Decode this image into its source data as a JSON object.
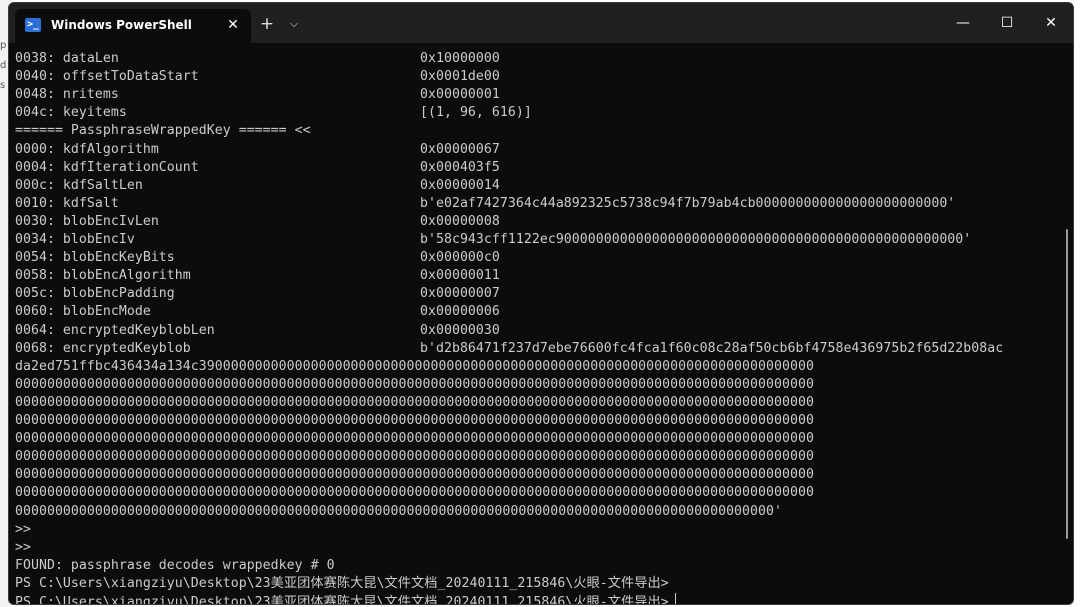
{
  "window": {
    "tab_title": "Windows PowerShell",
    "tab_icon": "powershell-icon",
    "close_tab_icon": "close-icon",
    "new_tab_icon": "plus-icon",
    "dropdown_icon": "chevron-down-icon",
    "minimize_icon": "minimize-icon",
    "maximize_icon": "maximize-icon",
    "close_icon": "close-icon"
  },
  "behind_window": {
    "fragments": [
      "p",
      "d",
      "s"
    ]
  },
  "terminal": {
    "rows": [
      {
        "key": "0038: dataLen",
        "value": "0x10000000"
      },
      {
        "key": "0040: offsetToDataStart",
        "value": "0x0001de00"
      },
      {
        "key": "0048: nritems",
        "value": "0x00000001"
      },
      {
        "key": "004c: keyitems",
        "value": "[(1, 96, 616)]"
      },
      {
        "key": "====== PassphraseWrappedKey ====== <<",
        "value": ""
      },
      {
        "key": "0000: kdfAlgorithm",
        "value": "0x00000067"
      },
      {
        "key": "0004: kdfIterationCount",
        "value": "0x000403f5"
      },
      {
        "key": "000c: kdfSaltLen",
        "value": "0x00000014"
      },
      {
        "key": "0010: kdfSalt",
        "value": "b'e02af7427364c44a892325c5738c94f7b79ab4cb000000000000000000000000'"
      },
      {
        "key": "0030: blobEncIvLen",
        "value": "0x00000008"
      },
      {
        "key": "0034: blobEncIv",
        "value": "b'58c943cff1122ec900000000000000000000000000000000000000000000000000'"
      },
      {
        "key": "0054: blobEncKeyBits",
        "value": "0x000000c0"
      },
      {
        "key": "0058: blobEncAlgorithm",
        "value": "0x00000011"
      },
      {
        "key": "005c: blobEncPadding",
        "value": "0x00000007"
      },
      {
        "key": "0060: blobEncMode",
        "value": "0x00000006"
      },
      {
        "key": "0064: encryptedKeyblobLen",
        "value": "0x00000030"
      },
      {
        "key": "0068: encryptedKeyblob",
        "value": "b'd2b86471f237d7ebe76600fc4fca1f60c08c28af50cb6bf4758e436975b2f65d22b08ac"
      }
    ],
    "wrapped_lines": [
      "da2ed751ffbc436434a134c39000000000000000000000000000000000000000000000000000000000000000000000000000",
      "0000000000000000000000000000000000000000000000000000000000000000000000000000000000000000000000000000",
      "0000000000000000000000000000000000000000000000000000000000000000000000000000000000000000000000000000",
      "0000000000000000000000000000000000000000000000000000000000000000000000000000000000000000000000000000",
      "0000000000000000000000000000000000000000000000000000000000000000000000000000000000000000000000000000",
      "0000000000000000000000000000000000000000000000000000000000000000000000000000000000000000000000000000",
      "0000000000000000000000000000000000000000000000000000000000000000000000000000000000000000000000000000",
      "0000000000000000000000000000000000000000000000000000000000000000000000000000000000000000000000000000",
      "00000000000000000000000000000000000000000000000000000000000000000000000000000000000000000000000'"
    ],
    "prompts": [
      ">>",
      ">>"
    ],
    "found": "FOUND: passphrase decodes wrappedkey # 0",
    "ps_lines": [
      "PS C:\\Users\\xiangziyu\\Desktop\\23美亚团体赛陈大昆\\文件文档_20240111_215846\\火眼-文件导出>",
      "PS C:\\Users\\xiangziyu\\Desktop\\23美亚团体赛陈大昆\\文件文档_20240111_215846\\火眼-文件导出>"
    ]
  }
}
